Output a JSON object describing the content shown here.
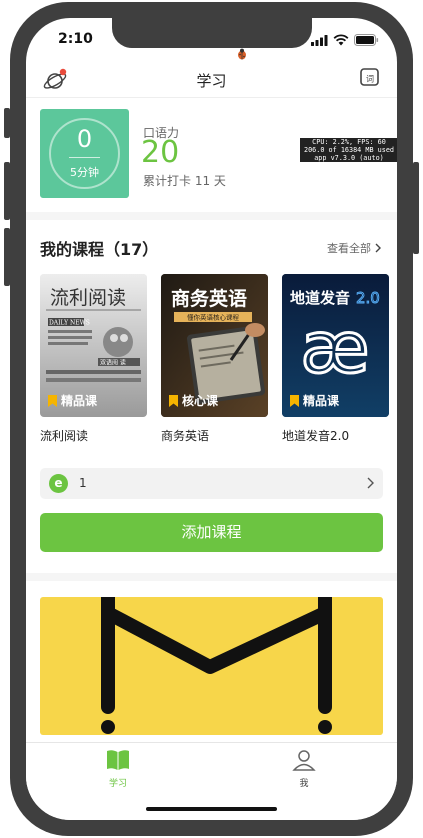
{
  "status_bar": {
    "time": "2:10"
  },
  "nav": {
    "title": "学习"
  },
  "stats": {
    "minutes_value": "0",
    "minutes_label": "5分钟",
    "oral_label": "口语力",
    "oral_score": "20",
    "checkin_text": "累计打卡 11 天"
  },
  "perf_overlay": {
    "line1": "CPU: 2.2%, FPS: 60",
    "line2": "206.0 of 16384 MB used",
    "line3": "app v7.3.0 (auto)"
  },
  "courses_section": {
    "title": "我的课程（17）",
    "view_all": "查看全部"
  },
  "courses": [
    {
      "name": "流利阅读",
      "badge": "精品课",
      "cover_title": "流利阅读",
      "cover_sub": "DAILY NEWS",
      "cover_caption": "双语阅 读"
    },
    {
      "name": "商务英语",
      "badge": "核心课",
      "cover_title": "商务英语",
      "cover_sub": "懂你英语核心课程"
    },
    {
      "name": "地道发音2.0",
      "badge": "精品课",
      "cover_title": "地道发音",
      "cover_version": "2.0",
      "cover_symbol": "æ"
    }
  ],
  "progress": {
    "icon_letter": "e",
    "value": "1"
  },
  "add_course_label": "添加课程",
  "tabs": [
    {
      "label": "学习",
      "active": true
    },
    {
      "label": "我",
      "active": false
    }
  ],
  "colors": {
    "brand_green": "#6cc441",
    "stat_card": "#5cc79b",
    "banner_yellow": "#f7d64a"
  }
}
